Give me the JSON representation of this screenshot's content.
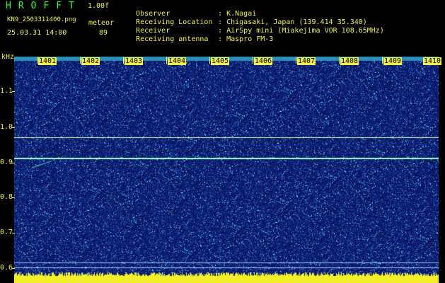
{
  "header": {
    "app_title": "HROFFT",
    "version": "1.00f",
    "file_name": "KN9_2503311400.png",
    "mode": "meteor",
    "datetime": "25.03.31 14:00",
    "count": "89",
    "info": [
      {
        "key": "Observer",
        "value": "K.Nagai"
      },
      {
        "key": "Receiving Location",
        "value": "Chigasaki, Japan (139.414 35.340)"
      },
      {
        "key": "Receiver",
        "value": "AirSpy mini (Miakejima VOR 108.65MHz)"
      },
      {
        "key": "Receiving antenna",
        "value": "Maspro FM-3"
      }
    ]
  },
  "axis": {
    "unit": "kHz",
    "freq_labels": [
      "1.1",
      "1.0",
      "0.9",
      "0.8",
      "0.7",
      "0.6"
    ],
    "time_labels": [
      "1401",
      "1402",
      "1403",
      "1404",
      "1405",
      "1406",
      "1407",
      "1408",
      "1409",
      "1410"
    ]
  },
  "colors": {
    "text_green": "#33ff33",
    "text_yellow": "#f2ef4a",
    "background": "#000000",
    "spectrum_base": "#0a1560",
    "signal": "#9fffd0"
  }
}
